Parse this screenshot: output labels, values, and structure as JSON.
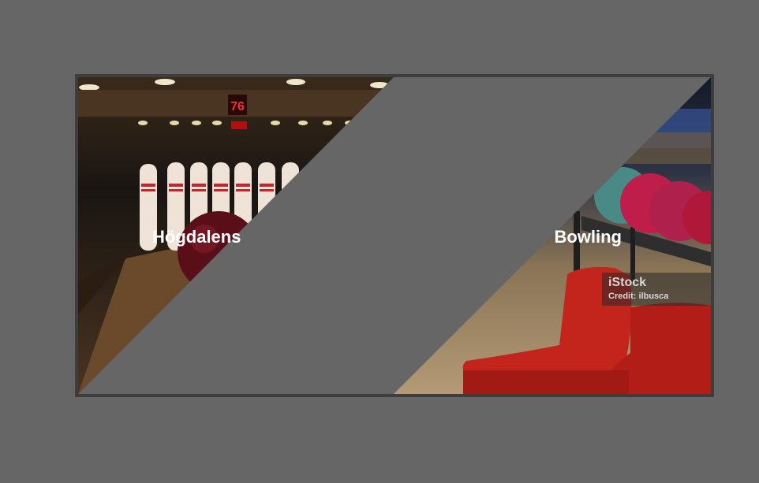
{
  "card": {
    "left_title": "Högdalens",
    "right_title": "Bowling",
    "watermark": {
      "brand": "iStock",
      "credit": "Credit: ilbusca"
    }
  },
  "images": [
    {
      "icon": "bowling-pins-photo"
    },
    {
      "icon": "bowling-balls-chairs-photo"
    }
  ]
}
